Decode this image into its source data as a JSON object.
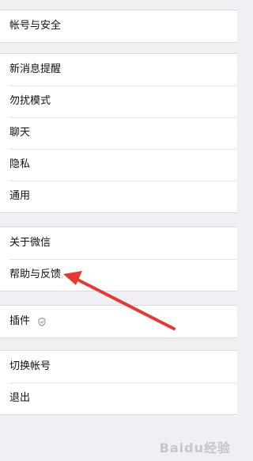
{
  "groups": [
    {
      "items": [
        {
          "label": "帐号与安全"
        }
      ]
    },
    {
      "items": [
        {
          "label": "新消息提醒"
        },
        {
          "label": "勿扰模式"
        },
        {
          "label": "聊天"
        },
        {
          "label": "隐私"
        },
        {
          "label": "通用"
        }
      ]
    },
    {
      "items": [
        {
          "label": "关于微信"
        },
        {
          "label": "帮助与反馈"
        }
      ]
    },
    {
      "items": [
        {
          "label": "插件",
          "icon": "shield-icon"
        }
      ]
    },
    {
      "items": [
        {
          "label": "切换帐号"
        },
        {
          "label": "退出"
        }
      ]
    }
  ],
  "annotation": {
    "color": "#e53935",
    "icon": "red-arrow-icon"
  },
  "watermark": {
    "text": "Baidu经验"
  }
}
